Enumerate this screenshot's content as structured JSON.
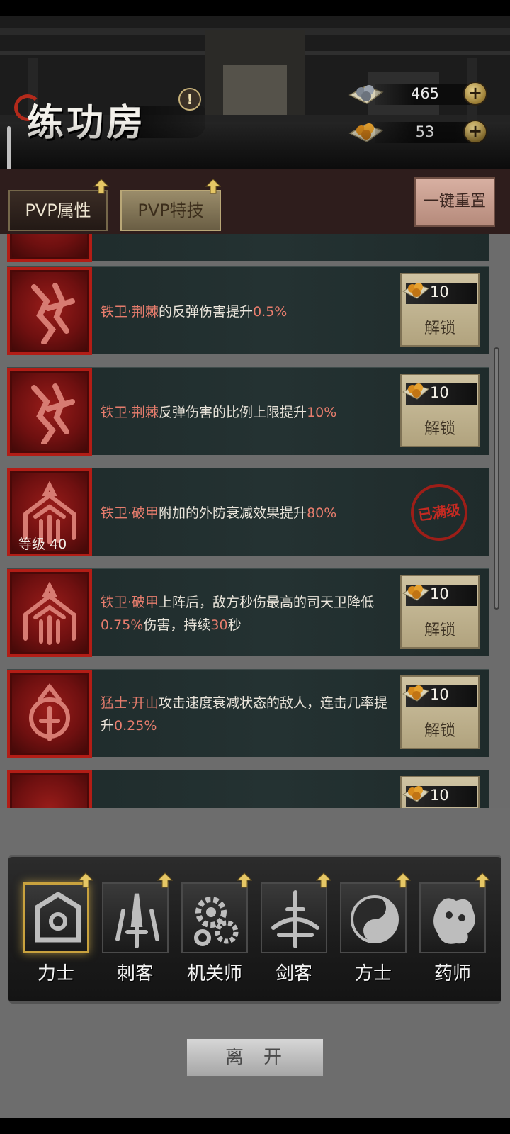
{
  "header": {
    "title": "练功房",
    "info_icon": "!",
    "currencies": [
      {
        "name": "silver-ore",
        "value": "465"
      },
      {
        "name": "gold-ore",
        "value": "53"
      }
    ],
    "plus_label": "+"
  },
  "tabs": [
    {
      "label": "PVP属性",
      "active": false
    },
    {
      "label": "PVP特技",
      "active": true
    }
  ],
  "reset_label": "一键重置",
  "skills": [
    {
      "pre": "铁卫·荆棘",
      "mid": "的反弹伤害提升",
      "val": "0.5%",
      "post": "",
      "cost": "10",
      "action": "解锁",
      "icon": "thorn-icon"
    },
    {
      "pre": "铁卫·荆棘",
      "mid": "反弹伤害的比例上限提升",
      "val": "10%",
      "post": "",
      "cost": "10",
      "action": "解锁",
      "icon": "thorn-icon"
    },
    {
      "pre": "铁卫·破甲",
      "mid": "附加的外防衰减效果提升",
      "val": "80%",
      "post": "",
      "maxed": "已满级",
      "level": "等级 40",
      "icon": "armor-break-icon"
    },
    {
      "pre": "铁卫·破甲",
      "mid": "上阵后，敌方秒伤最高的司天卫降低",
      "val": "0.75%",
      "post": "伤害，持续",
      "val2": "30",
      "post2": "秒",
      "cost": "10",
      "action": "解锁",
      "icon": "armor-break-icon"
    },
    {
      "pre": "猛士·开山",
      "mid": "攻击速度衰减状态的敌人，连击几率提升",
      "val": "0.25%",
      "post": "",
      "cost": "10",
      "action": "解锁",
      "icon": "mountain-icon"
    },
    {
      "cost": "10"
    }
  ],
  "classes": [
    {
      "name": "力士",
      "icon": "strongman-icon",
      "active": true
    },
    {
      "name": "刺客",
      "icon": "assassin-icon",
      "active": false
    },
    {
      "name": "机关师",
      "icon": "mechanist-icon",
      "active": false
    },
    {
      "name": "剑客",
      "icon": "swordsman-icon",
      "active": false
    },
    {
      "name": "方士",
      "icon": "taoist-icon",
      "active": false
    },
    {
      "name": "药师",
      "icon": "herbalist-icon",
      "active": false
    }
  ],
  "leave_label": "离开",
  "colors": {
    "highlight": "#e77d6d",
    "accent_gold": "#c9a23e",
    "icon_red": "#b21d16"
  }
}
